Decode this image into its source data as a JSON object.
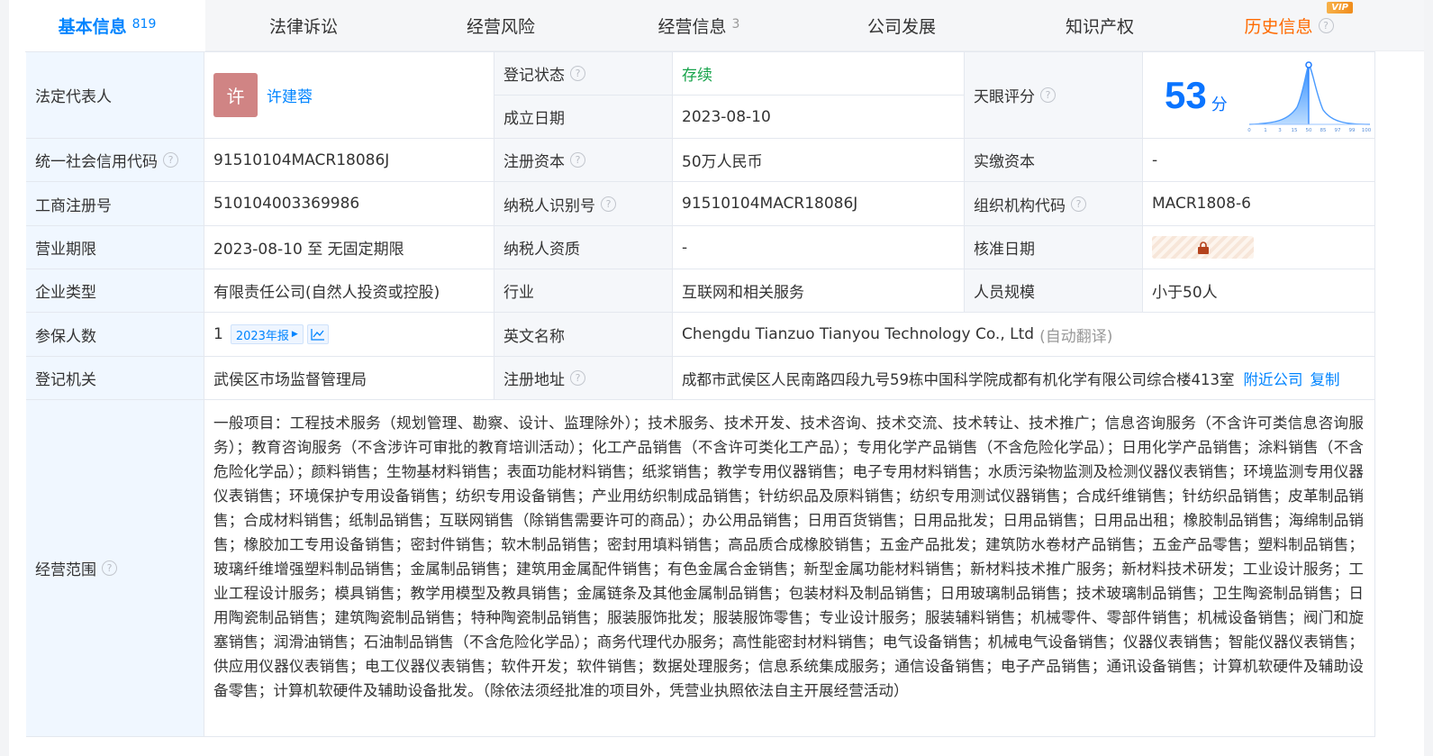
{
  "tabs": [
    {
      "label": "基本信息",
      "count": "819",
      "active": true
    },
    {
      "label": "法律诉讼"
    },
    {
      "label": "经营风险"
    },
    {
      "label": "经营信息",
      "count": "3"
    },
    {
      "label": "公司发展"
    },
    {
      "label": "知识产权"
    },
    {
      "label": "历史信息",
      "vip": "VIP"
    }
  ],
  "colors": {
    "accent": "#0084ff",
    "status_green": "#16a34a",
    "history_orange": "#ff6a00",
    "label_bg": "#f0f7ff"
  },
  "info": {
    "legal_rep_label": "法定代表人",
    "legal_rep_avatar": "许",
    "legal_rep_name": "许建蓉",
    "status_label": "登记状态",
    "status_value": "存续",
    "established_label": "成立日期",
    "established_value": "2023-08-10",
    "tianyan_label": "天眼评分",
    "tianyan_score": "53",
    "tianyan_unit": "分",
    "tianyan_axis": [
      "0",
      "1",
      "3",
      "15",
      "50",
      "85",
      "97",
      "99",
      "100"
    ],
    "credit_code_label": "统一社会信用代码",
    "credit_code_value": "91510104MACR18086J",
    "reg_capital_label": "注册资本",
    "reg_capital_value": "50万人民币",
    "paid_capital_label": "实缴资本",
    "paid_capital_value": "-",
    "biz_reg_no_label": "工商注册号",
    "biz_reg_no_value": "510104003369986",
    "taxpayer_id_label": "纳税人识别号",
    "taxpayer_id_value": "91510104MACR18086J",
    "org_code_label": "组织机构代码",
    "org_code_value": "MACR1808-6",
    "biz_term_label": "营业期限",
    "biz_term_value": "2023-08-10 至 无固定期限",
    "taxpayer_qual_label": "纳税人资质",
    "taxpayer_qual_value": "-",
    "approval_date_label": "核准日期",
    "company_type_label": "企业类型",
    "company_type_value": "有限责任公司(自然人投资或控股)",
    "industry_label": "行业",
    "industry_value": "互联网和相关服务",
    "staff_size_label": "人员规模",
    "staff_size_value": "小于50人",
    "insured_label": "参保人数",
    "insured_value": "1",
    "insured_report": "2023年报",
    "english_name_label": "英文名称",
    "english_name_value": "Chengdu Tianzuo Tianyou Technology Co., Ltd",
    "english_name_note": "(自动翻译)",
    "reg_authority_label": "登记机关",
    "reg_authority_value": "武侯区市场监督管理局",
    "reg_address_label": "注册地址",
    "reg_address_value": "成都市武侯区人民南路四段九号59栋中国科学院成都有机化学有限公司综合楼413室",
    "nearby_link": "附近公司",
    "copy_link": "复制",
    "scope_label": "经营范围",
    "scope_value": "一般项目：工程技术服务（规划管理、勘察、设计、监理除外）；技术服务、技术开发、技术咨询、技术交流、技术转让、技术推广；信息咨询服务（不含许可类信息咨询服务）；教育咨询服务（不含涉许可审批的教育培训活动）；化工产品销售（不含许可类化工产品）；专用化学产品销售（不含危险化学品）；日用化学产品销售；涂料销售（不含危险化学品）；颜料销售；生物基材料销售；表面功能材料销售；纸浆销售；教学专用仪器销售；电子专用材料销售；水质污染物监测及检测仪器仪表销售；环境监测专用仪器仪表销售；环境保护专用设备销售；纺织专用设备销售；产业用纺织制成品销售；针纺织品及原料销售；纺织专用测试仪器销售；合成纤维销售；针纺织品销售；皮革制品销售；合成材料销售；纸制品销售；互联网销售（除销售需要许可的商品）；办公用品销售；日用百货销售；日用品批发；日用品销售；日用品出租；橡胶制品销售；海绵制品销售；橡胶加工专用设备销售；密封件销售；软木制品销售；密封用填料销售；高品质合成橡胶销售；五金产品批发；建筑防水卷材产品销售；五金产品零售；塑料制品销售；玻璃纤维增强塑料制品销售；金属制品销售；建筑用金属配件销售；有色金属合金销售；新型金属功能材料销售；新材料技术推广服务；新材料技术研发；工业设计服务；工业工程设计服务；模具销售；教学用模型及教具销售；金属链条及其他金属制品销售；包装材料及制品销售；日用玻璃制品销售；技术玻璃制品销售；卫生陶瓷制品销售；日用陶瓷制品销售；建筑陶瓷制品销售；特种陶瓷制品销售；服装服饰批发；服装服饰零售；专业设计服务；服装辅料销售；机械零件、零部件销售；机械设备销售；阀门和旋塞销售；润滑油销售；石油制品销售（不含危险化学品）；商务代理代办服务；高性能密封材料销售；电气设备销售；机械电气设备销售；仪器仪表销售；智能仪器仪表销售；供应用仪器仪表销售；电工仪器仪表销售；软件开发；软件销售；数据处理服务；信息系统集成服务；通信设备销售；电子产品销售；通讯设备销售；计算机软硬件及辅助设备零售；计算机软硬件及辅助设备批发。（除依法须经批准的项目外，凭营业执照依法自主开展经营活动）"
  }
}
